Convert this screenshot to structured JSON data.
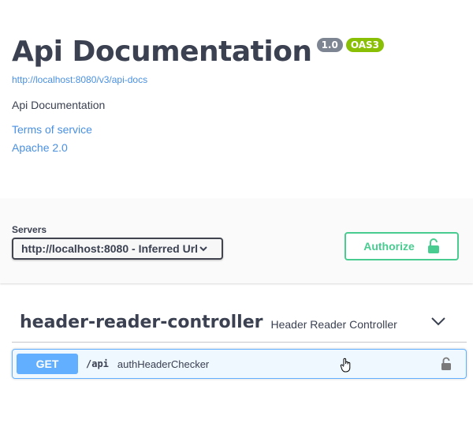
{
  "info": {
    "title": "Api Documentation",
    "version_badge": "1.0",
    "oas_badge": "OAS3",
    "api_docs_url": "http://localhost:8080/v3/api-docs",
    "description": "Api Documentation",
    "terms_link": "Terms of service",
    "license_link": "Apache 2.0"
  },
  "scheme": {
    "servers_label": "Servers",
    "selected_server": "http://localhost:8080 - Inferred Url",
    "authorize_label": "Authorize"
  },
  "tag": {
    "name": "header-reader-controller",
    "description": "Header Reader Controller"
  },
  "operation": {
    "method": "GET",
    "path": "/api",
    "summary": "authHeaderChecker"
  },
  "colors": {
    "get_method": "#61affe",
    "authorize": "#49cc90",
    "version_badge": "#7d8492",
    "oas_badge": "#89bf04",
    "link": "#4990e2"
  }
}
